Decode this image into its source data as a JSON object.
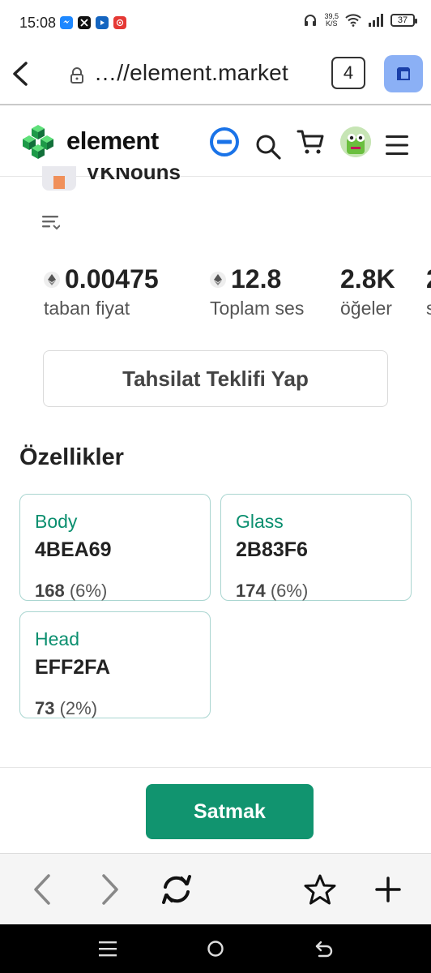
{
  "status_bar": {
    "time": "15:08",
    "network_speed_value": "39,5",
    "network_speed_unit": "K/S",
    "battery": "37",
    "app_icons": [
      "messenger-icon",
      "x-icon",
      "video-icon",
      "target-icon"
    ]
  },
  "browser": {
    "url": "…//element.market",
    "tab_count": "4"
  },
  "site_header": {
    "logo_text": "element",
    "accent_color": "#1a73e8"
  },
  "collection": {
    "name": "VKNouns"
  },
  "stats": [
    {
      "value": "0.00475",
      "label": "taban fiyat",
      "eth": true
    },
    {
      "value": "12.8",
      "label": "Toplam ses",
      "eth": true
    },
    {
      "value": "2.8K",
      "label": "öğeler",
      "eth": false
    },
    {
      "value": "2",
      "label": "s",
      "eth": false
    }
  ],
  "offer_button_label": "Tahsilat Teklifi Yap",
  "traits_section": {
    "title": "Özellikler",
    "items": [
      {
        "type": "Body",
        "value": "4BEA69",
        "count": "168",
        "percent": "(6%)"
      },
      {
        "type": "Glass",
        "value": "2B83F6",
        "count": "174",
        "percent": "(6%)"
      },
      {
        "type": "Head",
        "value": "EFF2FA",
        "count": "73",
        "percent": "(2%)"
      }
    ]
  },
  "sell_button_label": "Satmak",
  "colors": {
    "brand_green": "#11946f",
    "trait_border": "#a9d5d0",
    "trait_type": "#0b8f6f"
  }
}
